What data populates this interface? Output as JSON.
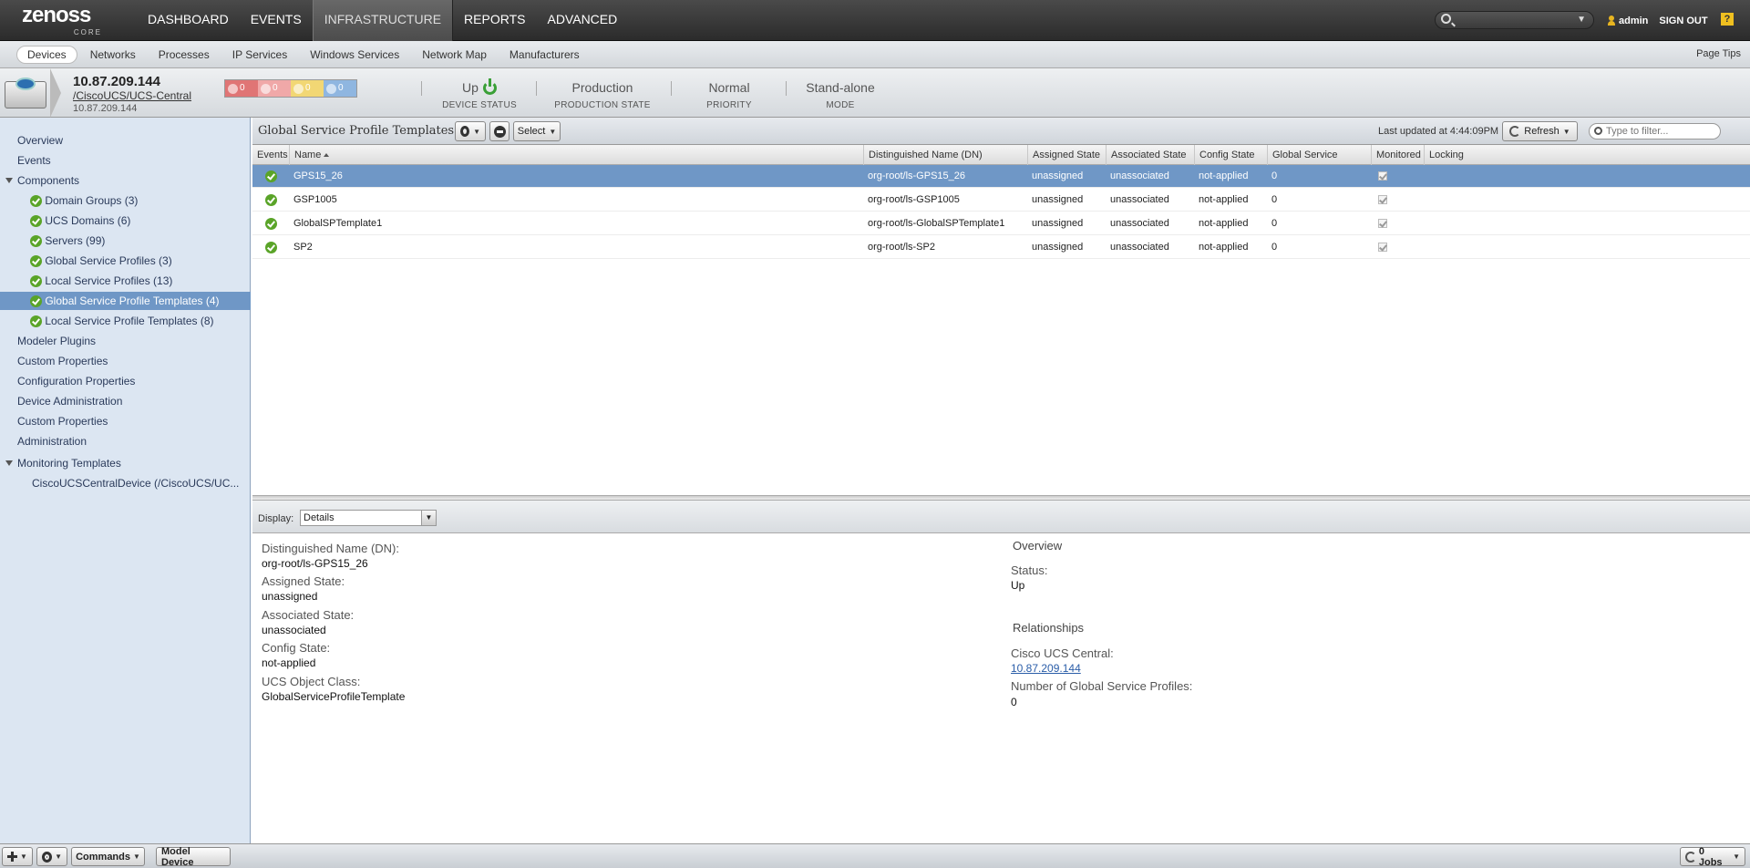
{
  "brand": {
    "logo_text": "zenoss",
    "logo_sub": "CORE"
  },
  "main_nav": [
    {
      "label": "DASHBOARD",
      "active": false
    },
    {
      "label": "EVENTS",
      "active": false
    },
    {
      "label": "INFRASTRUCTURE",
      "active": true
    },
    {
      "label": "REPORTS",
      "active": false
    },
    {
      "label": "ADVANCED",
      "active": false
    }
  ],
  "user": {
    "name": "admin",
    "signout": "SIGN OUT",
    "help": "?"
  },
  "sub_nav": {
    "items": [
      "Devices",
      "Networks",
      "Processes",
      "IP Services",
      "Windows Services",
      "Network Map",
      "Manufacturers"
    ],
    "active": "Devices",
    "page_tips": "Page Tips"
  },
  "device": {
    "name": "10.87.209.144",
    "path": "/CiscoUCS/UCS-Central",
    "ip": "10.87.209.144",
    "event_counts": [
      {
        "severity": "critical",
        "count": "0",
        "color": "#e07575"
      },
      {
        "severity": "error",
        "count": "0",
        "color": "#f0a8a8"
      },
      {
        "severity": "warning",
        "count": "0",
        "color": "#f2d774"
      },
      {
        "severity": "info",
        "count": "0",
        "color": "#8fb6e0"
      }
    ],
    "status": [
      {
        "value": "Up",
        "label": "DEVICE STATUS"
      },
      {
        "value": "Production",
        "label": "PRODUCTION STATE"
      },
      {
        "value": "Normal",
        "label": "PRIORITY"
      },
      {
        "value": "Stand-alone",
        "label": "MODE"
      }
    ]
  },
  "sidebar": {
    "items": [
      {
        "label": "Overview",
        "level": 0
      },
      {
        "label": "Events",
        "level": 0
      },
      {
        "label": "Components",
        "level": 0,
        "expander": true
      },
      {
        "label": "Domain Groups (3)",
        "level": 1,
        "ok": true
      },
      {
        "label": "UCS Domains (6)",
        "level": 1,
        "ok": true
      },
      {
        "label": "Servers (99)",
        "level": 1,
        "ok": true
      },
      {
        "label": "Global Service Profiles (3)",
        "level": 1,
        "ok": true
      },
      {
        "label": "Local Service Profiles (13)",
        "level": 1,
        "ok": true
      },
      {
        "label": "Global Service Profile Templates (4)",
        "level": 1,
        "ok": true,
        "selected": true
      },
      {
        "label": "Local Service Profile Templates (8)",
        "level": 1,
        "ok": true
      },
      {
        "label": "Modeler Plugins",
        "level": 0
      },
      {
        "label": "Custom Properties",
        "level": 0
      },
      {
        "label": "Configuration Properties",
        "level": 0
      },
      {
        "label": "Device Administration",
        "level": 0
      },
      {
        "label": "Custom Properties",
        "level": 0
      },
      {
        "label": "Administration",
        "level": 0
      },
      {
        "label": "Monitoring Templates",
        "level": 0,
        "expander": true
      },
      {
        "label": "CiscoUCSCentralDevice (/CiscoUCS/UC...",
        "level": 2
      }
    ]
  },
  "grid": {
    "title": "Global Service Profile Templates",
    "select_label": "Select",
    "last_updated": "Last updated at 4:44:09PM",
    "refresh_label": "Refresh",
    "filter_placeholder": "Type to filter...",
    "columns": [
      "Events",
      "Name",
      "Distinguished Name (DN)",
      "Assigned State",
      "Associated State",
      "Config State",
      "Global Service Profiles",
      "Monitored",
      "Locking"
    ],
    "rows": [
      {
        "name": "GPS15_26",
        "dn": "org-root/ls-GPS15_26",
        "assigned": "unassigned",
        "associated": "unassociated",
        "config": "not-applied",
        "gsp": "0",
        "monitored": true,
        "selected": true
      },
      {
        "name": "GSP1005",
        "dn": "org-root/ls-GSP1005",
        "assigned": "unassigned",
        "associated": "unassociated",
        "config": "not-applied",
        "gsp": "0",
        "monitored": true
      },
      {
        "name": "GlobalSPTemplate1",
        "dn": "org-root/ls-GlobalSPTemplate1",
        "assigned": "unassigned",
        "associated": "unassociated",
        "config": "not-applied",
        "gsp": "0",
        "monitored": true
      },
      {
        "name": "SP2",
        "dn": "org-root/ls-SP2",
        "assigned": "unassigned",
        "associated": "unassociated",
        "config": "not-applied",
        "gsp": "0",
        "monitored": true
      }
    ]
  },
  "detail": {
    "display_label": "Display:",
    "display_value": "Details",
    "left": [
      {
        "label": "Distinguished Name (DN):",
        "value": "org-root/ls-GPS15_26"
      },
      {
        "label": "Assigned State:",
        "value": "unassigned"
      },
      {
        "label": "Associated State:",
        "value": "unassociated"
      },
      {
        "label": "Config State:",
        "value": "not-applied"
      },
      {
        "label": "UCS Object Class:",
        "value": "GlobalServiceProfileTemplate"
      }
    ],
    "overview_title": "Overview",
    "status_label": "Status:",
    "status_value": "Up",
    "relationships_title": "Relationships",
    "central_label": "Cisco UCS Central:",
    "central_value": "10.87.209.144",
    "num_gsp_label": "Number of Global Service Profiles:",
    "num_gsp_value": "0"
  },
  "bottom": {
    "commands": "Commands",
    "model_device": "Model Device",
    "jobs": "0 Jobs"
  }
}
